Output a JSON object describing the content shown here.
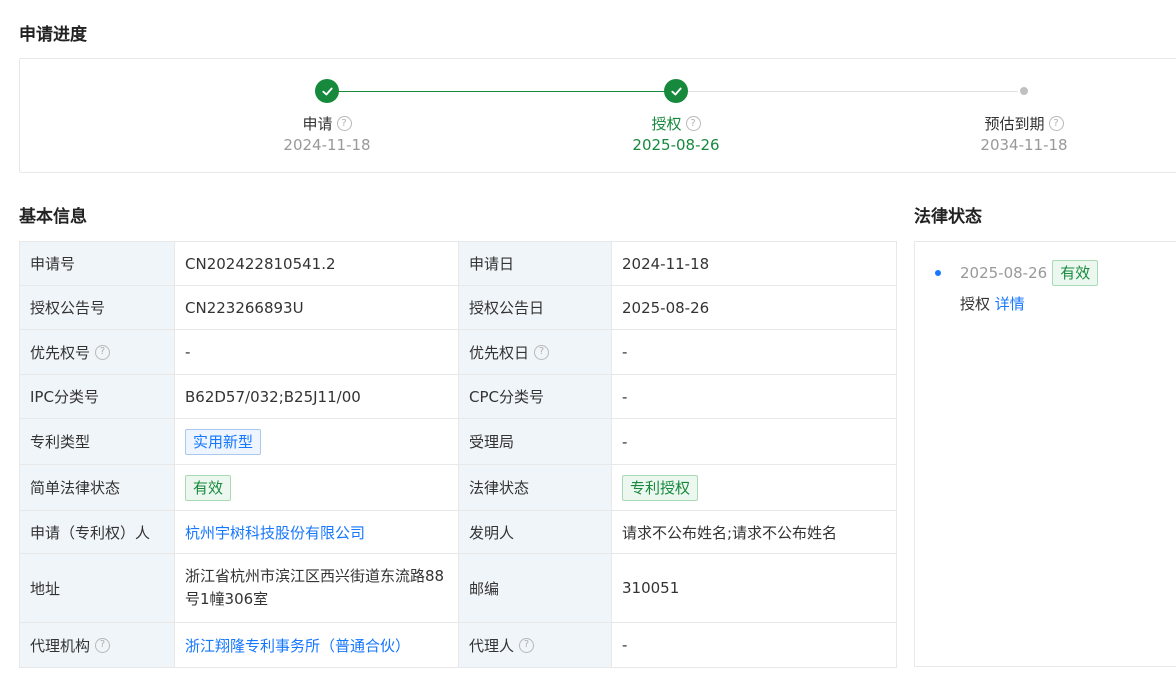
{
  "progress": {
    "title": "申请进度",
    "steps": [
      {
        "label": "申请",
        "date": "2024-11-18"
      },
      {
        "label": "授权",
        "date": "2025-08-26"
      },
      {
        "label": "预估到期",
        "date": "2034-11-18"
      }
    ],
    "help_glyph": "?",
    "done_color": "#17893d",
    "todo_color": "#c0c0c0"
  },
  "basic": {
    "title": "基本信息",
    "rows": [
      {
        "k1": "申请号",
        "v1": "CN202422810541.2",
        "k2": "申请日",
        "v2": "2024-11-18"
      },
      {
        "k1": "授权公告号",
        "v1": "CN223266893U",
        "k2": "授权公告日",
        "v2": "2025-08-26"
      },
      {
        "k1": "优先权号",
        "v1": "-",
        "k2": "优先权日",
        "v2": "-"
      },
      {
        "k1": "IPC分类号",
        "v1": "B62D57/032;B25J11/00",
        "k2": "CPC分类号",
        "v2": "-"
      },
      {
        "k1": "专利类型",
        "v1": "实用新型",
        "k2": "受理局",
        "v2": "-"
      },
      {
        "k1": "简单法律状态",
        "v1": "有效",
        "k2": "法律状态",
        "v2": "专利授权"
      },
      {
        "k1": "申请（专利权）人",
        "v1": "杭州宇树科技股份有限公司",
        "k2": "发明人",
        "v2": "请求不公布姓名;请求不公布姓名"
      },
      {
        "k1": "地址",
        "v1": "浙江省杭州市滨江区西兴街道东流路88号1幢306室",
        "k2": "邮编",
        "v2": "310051"
      },
      {
        "k1": "代理机构",
        "v1": "浙江翔隆专利事务所（普通合伙）",
        "k2": "代理人",
        "v2": "-"
      }
    ]
  },
  "legal": {
    "title": "法律状态",
    "date": "2025-08-26",
    "badge": "有效",
    "event": "授权",
    "detail_link": "详情"
  },
  "colors": {
    "accent_blue": "#1677ff",
    "accent_green": "#17893d",
    "key_bg": "#f0f5fa",
    "border": "#e8e8e8"
  }
}
